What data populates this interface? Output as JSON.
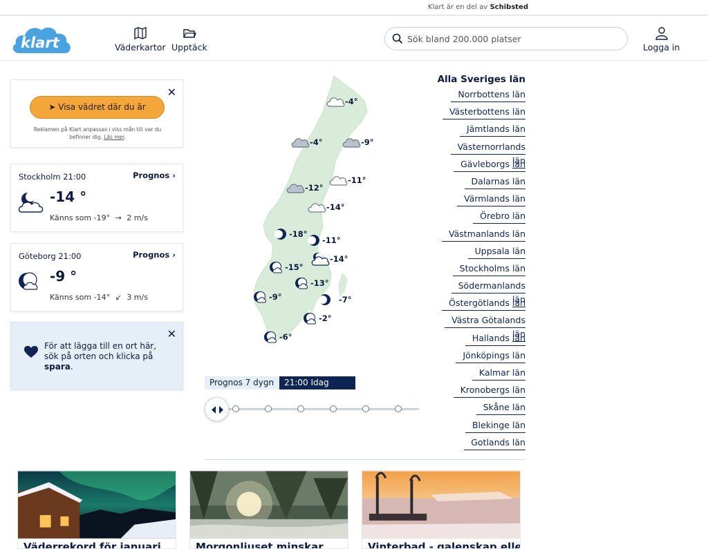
{
  "topbar": {
    "text": "Klart är en del av",
    "brand": "Schibsted"
  },
  "header": {
    "logo_text": "klart",
    "nav": [
      {
        "label": "Väderkartor",
        "icon": "map-icon"
      },
      {
        "label": "Upptäck",
        "icon": "folder-icon"
      }
    ],
    "search_placeholder": "Sök bland 200.000 platser",
    "login_label": "Logga in"
  },
  "location_prompt": {
    "button_label": "Visa vädret där du är",
    "note": "Reklamen på Klart anpassas i viss mån till var du befinner dig.",
    "note_link": "Läs mer"
  },
  "cities": [
    {
      "name": "Stockholm 21:00",
      "link": "Prognos",
      "temp": "-14 °",
      "feels": "Känns som -19°",
      "wind": "2 m/s",
      "icon": "partly-cloudy-night-icon",
      "wind_arrow": "→"
    },
    {
      "name": "Göteborg 21:00",
      "link": "Prognos",
      "temp": "-9 °",
      "feels": "Känns som -14°",
      "wind": "3 m/s",
      "icon": "moon-cloud-icon",
      "wind_arrow": "↙"
    }
  ],
  "favorite_tip": {
    "text": "För att lägga till en ort här, sök på orten och klicka på",
    "bold": "spara",
    "end": "."
  },
  "map": {
    "pins": [
      {
        "temp": "-4°",
        "icon": "cloud"
      },
      {
        "temp": "-4°",
        "icon": "cloud-dark"
      },
      {
        "temp": "-9°",
        "icon": "cloud-dark"
      },
      {
        "temp": "-12°",
        "icon": "cloud-dark"
      },
      {
        "temp": "-11°",
        "icon": "cloud"
      },
      {
        "temp": "-14°",
        "icon": "cloud"
      },
      {
        "temp": "-18°",
        "icon": "moon"
      },
      {
        "temp": "-11°",
        "icon": "moon"
      },
      {
        "temp": "-14°",
        "icon": "moon-cloud"
      },
      {
        "temp": "-15°",
        "icon": "moon-cloud"
      },
      {
        "temp": "-13°",
        "icon": "moon-cloud"
      },
      {
        "temp": "-9°",
        "icon": "moon-cloud"
      },
      {
        "temp": "-7°",
        "icon": "moon"
      },
      {
        "temp": "-2°",
        "icon": "moon-cloud"
      },
      {
        "temp": "-6°",
        "icon": "moon-cloud"
      }
    ],
    "map_color": "#d9ecd9"
  },
  "forecast_bar": {
    "label": "Prognos 7 dygn",
    "selected": "21:00 Idag"
  },
  "regions": {
    "title": "Alla Sveriges län",
    "items": [
      "Norrbottens län",
      "Västerbottens län",
      "Jämtlands län",
      "Västernorrlands län",
      "Gävleborgs län",
      "Dalarnas län",
      "Värmlands län",
      "Örebro län",
      "Västmanlands län",
      "Uppsala län",
      "Stockholms län",
      "Södermanlands län",
      "Östergötlands län",
      "Västra Götalands län",
      "Hallands län",
      "Jönköpings län",
      "Kalmar län",
      "Kronobergs län",
      "Skåne län",
      "Blekinge län",
      "Gotlands län"
    ]
  },
  "articles": [
    {
      "title": "Väderrekord för januari"
    },
    {
      "title": "Morgonljuset minskar"
    },
    {
      "title": "Vinterbad - galenskap eller"
    }
  ],
  "colors": {
    "accent": "#f3a73a",
    "navy": "#0d2552",
    "logo": "#4aa3e0"
  }
}
